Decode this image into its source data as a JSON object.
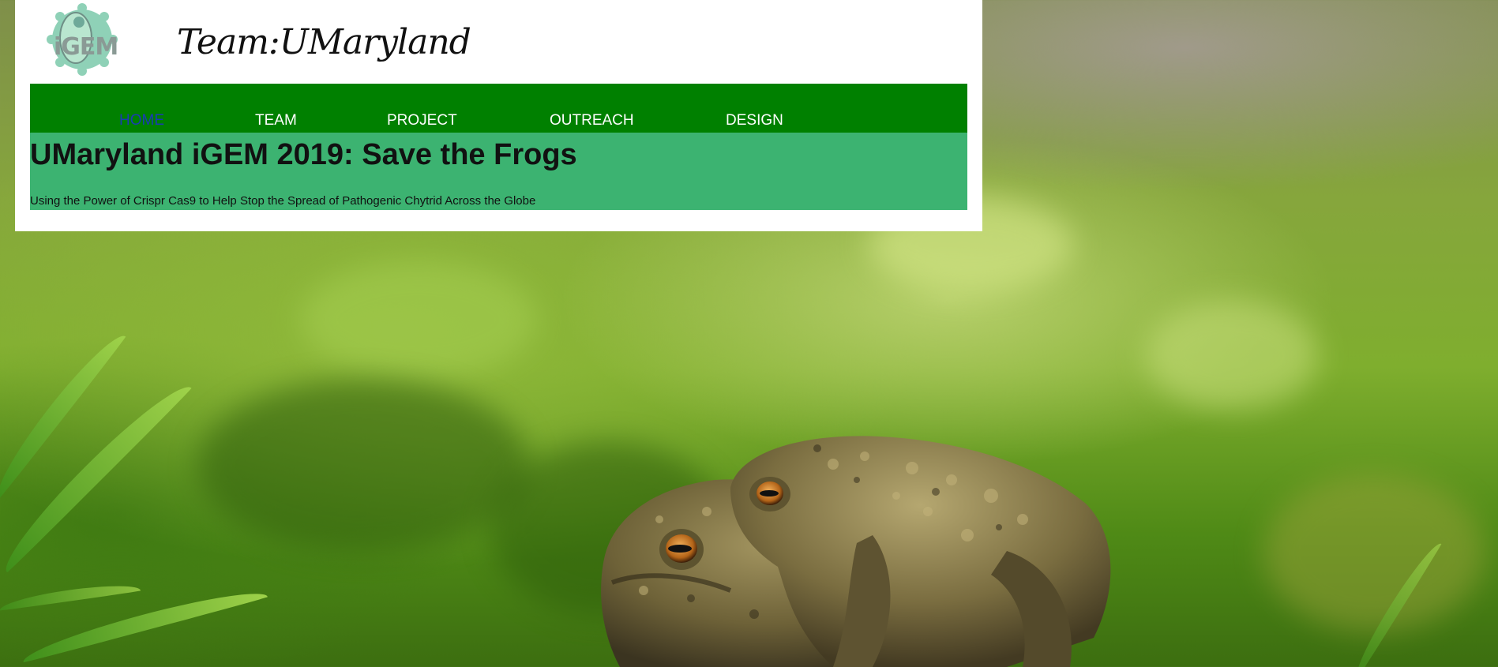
{
  "header": {
    "logo_text": "iGEM",
    "team_title": "Team:UMaryland"
  },
  "nav": {
    "items": [
      {
        "label": "HOME",
        "active": true
      },
      {
        "label": "TEAM",
        "active": false
      },
      {
        "label": "PROJECT",
        "active": false
      },
      {
        "label": "OUTREACH",
        "active": false
      },
      {
        "label": "DESIGN",
        "active": false
      }
    ]
  },
  "hero": {
    "title": "UMaryland iGEM 2019: Save the Frogs",
    "subtitle": "Using the Power of Crispr Cas9 to Help Stop the Spread of Pathogenic Chytrid Across the Globe"
  },
  "colors": {
    "nav_background": "#008000",
    "hero_background": "#3cb371",
    "active_link": "#1a3bb3",
    "nav_link": "#ffffff"
  }
}
